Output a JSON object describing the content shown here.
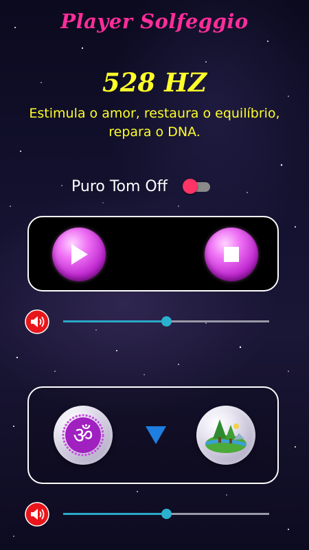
{
  "app": {
    "title": "Player Solfeggio"
  },
  "frequency": {
    "value": "528 HZ",
    "description": "Estimula o amor, restaura o equilíbrio, repara o DNA."
  },
  "pure_tone": {
    "label": "Puro Tom Off",
    "enabled": false
  },
  "player": {
    "play_icon": "play-icon",
    "stop_icon": "stop-icon"
  },
  "volume_main": {
    "icon": "volume-icon",
    "level": 0.5
  },
  "ambient": {
    "left_icon": "om-icon",
    "middle_icon": "arrow-down-icon",
    "right_icon": "nature-landscape-icon"
  },
  "volume_ambient": {
    "icon": "volume-icon",
    "level": 0.5
  },
  "colors": {
    "title": "#ff2d9a",
    "frequency": "#ffff2a",
    "accent": "#2bb1cf",
    "switch_thumb": "#ff3366",
    "orb": "#c02ad0"
  }
}
